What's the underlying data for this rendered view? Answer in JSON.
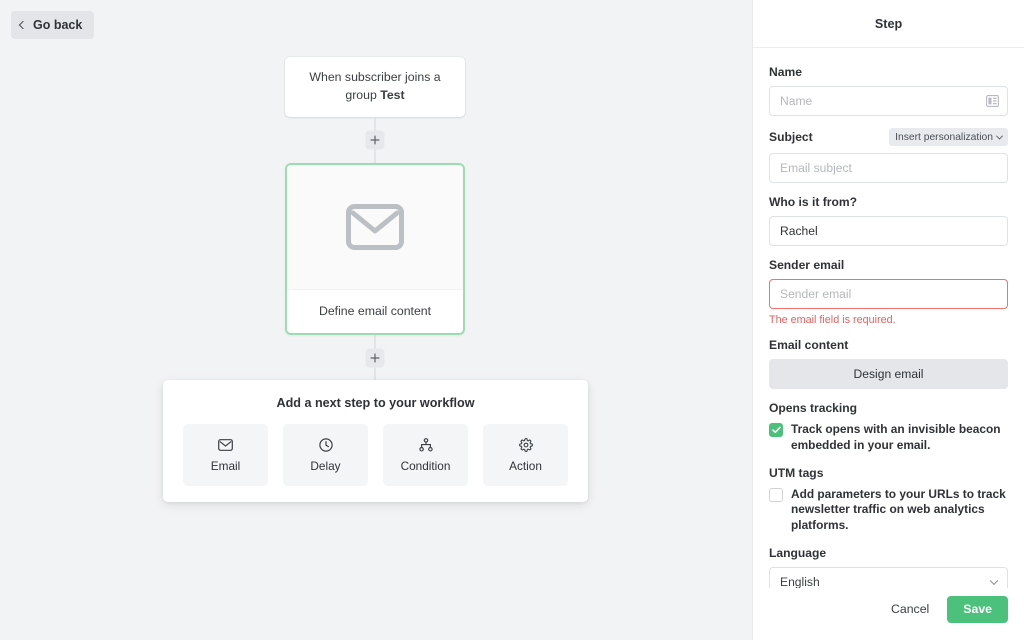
{
  "canvas": {
    "go_back_label": "Go back",
    "trigger": {
      "text_prefix": "When subscriber joins a group ",
      "text_bold": "Test"
    },
    "email_node": {
      "label": "Define email content",
      "icon": "envelope-icon",
      "border_color": "#9bdcb3"
    },
    "add_step_plus_label": "+",
    "next_step": {
      "title": "Add a next step to your workflow",
      "options": [
        {
          "label": "Email",
          "icon": "envelope-icon"
        },
        {
          "label": "Delay",
          "icon": "clock-icon"
        },
        {
          "label": "Condition",
          "icon": "hierarchy-icon"
        },
        {
          "label": "Action",
          "icon": "gear-icon"
        }
      ]
    }
  },
  "panel": {
    "header_title": "Step",
    "name": {
      "label": "Name",
      "value": "",
      "placeholder": "Name",
      "icon": "layout-template-icon"
    },
    "subject": {
      "label": "Subject",
      "personalization_button": "Insert personalization",
      "value": "",
      "placeholder": "Email subject"
    },
    "from": {
      "label": "Who is it from?",
      "value": "Rachel",
      "placeholder": "Who is it from?"
    },
    "sender_email": {
      "label": "Sender email",
      "value": "",
      "placeholder": "Sender email",
      "error": "The email field is required.",
      "error_color": "#e8605e"
    },
    "email_content": {
      "label": "Email content",
      "button_label": "Design email"
    },
    "opens_tracking": {
      "label": "Opens tracking",
      "checkbox_text": "Track opens with an invisible beacon embedded in your email.",
      "checked": true,
      "check_color": "#4cc17c"
    },
    "utm_tags": {
      "label": "UTM tags",
      "checkbox_text": "Add parameters to your URLs to track newsletter traffic on web analytics platforms.",
      "checked": false
    },
    "language": {
      "label": "Language",
      "value": "English"
    },
    "footer": {
      "cancel_label": "Cancel",
      "save_label": "Save",
      "save_color": "#4cc17c"
    }
  }
}
